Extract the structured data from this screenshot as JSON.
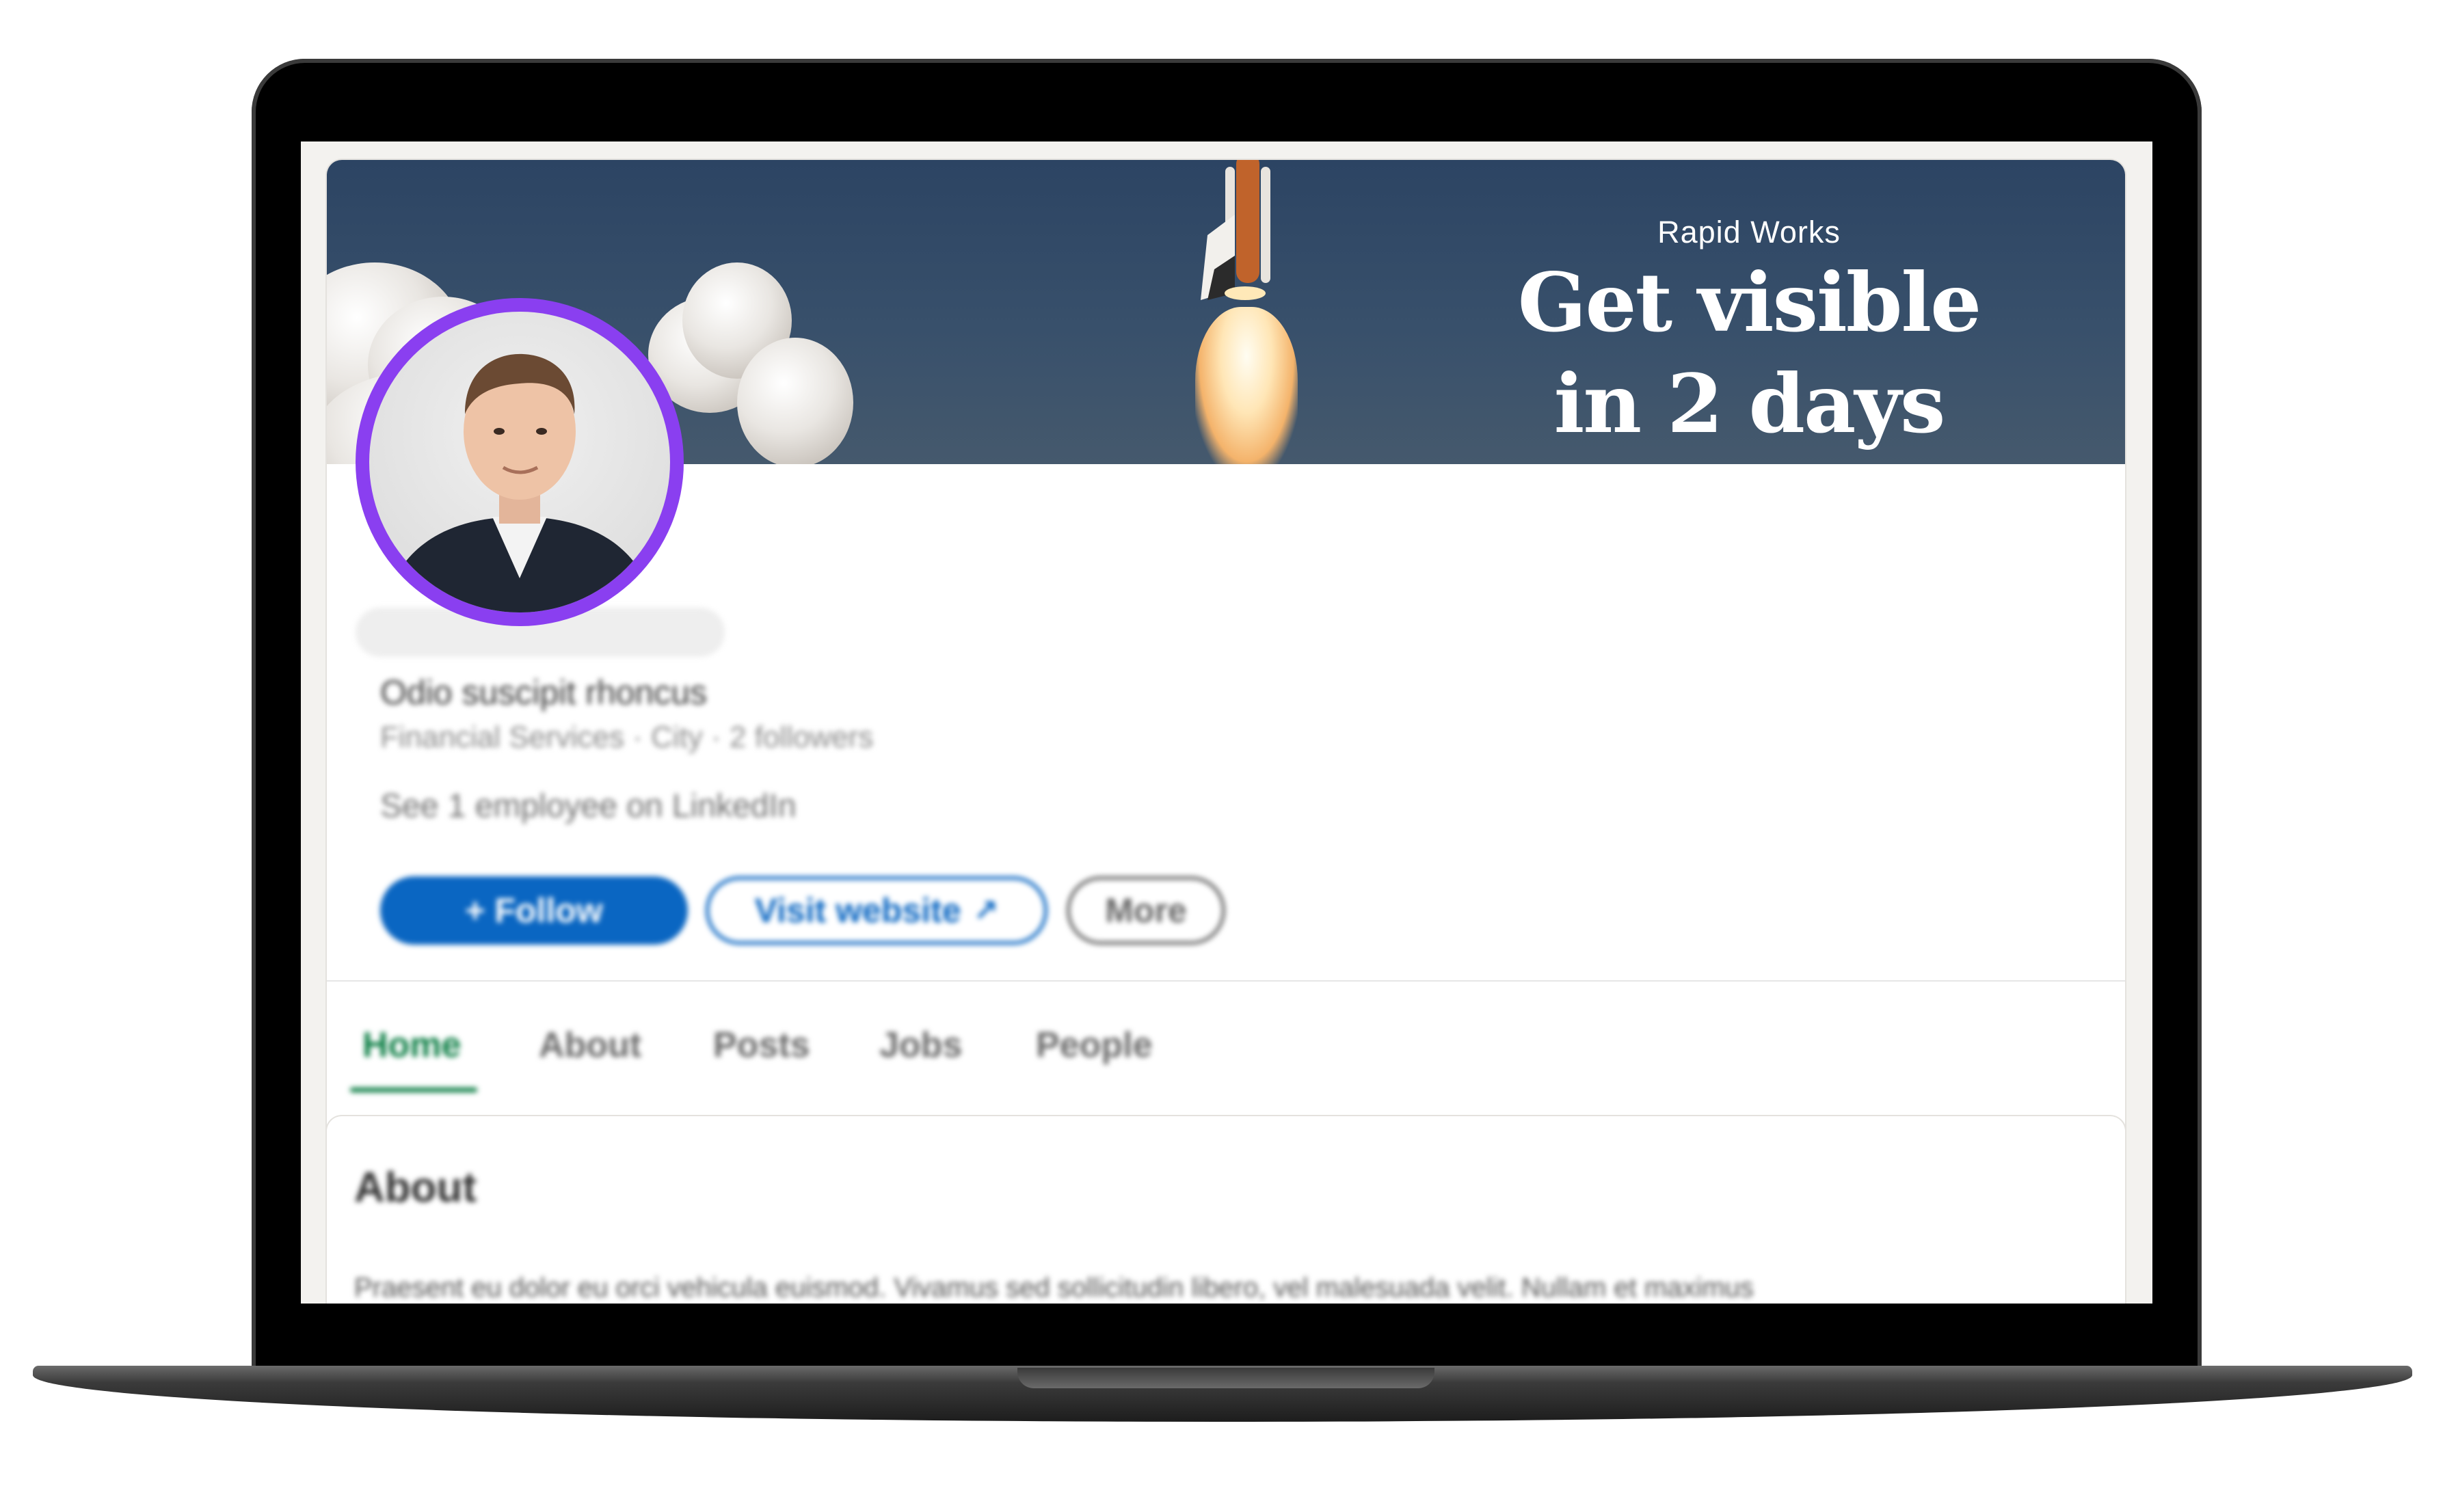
{
  "cover": {
    "brand": "Rapid Works",
    "headline_line1": "Get visible",
    "headline_line2": "in 2 days"
  },
  "company": {
    "name": "",
    "tagline": "Odio suscipit rhoncus",
    "meta": "Financial Services · City · 2 followers",
    "employees_link": "See 1 employee on LinkedIn"
  },
  "actions": {
    "follow_label": "+ Follow",
    "visit_label": "Visit website",
    "more_label": "More"
  },
  "tabs": [
    {
      "label": "Home",
      "active": true
    },
    {
      "label": "About",
      "active": false
    },
    {
      "label": "Posts",
      "active": false
    },
    {
      "label": "Jobs",
      "active": false
    },
    {
      "label": "People",
      "active": false
    }
  ],
  "about": {
    "heading": "About",
    "text": "Praesent eu dolor eu orci vehicula euismod. Vivamus sed sollicitudin libero, vel malesuada velit. Nullam et maximus"
  },
  "colors": {
    "accent_blue": "#0a66c2",
    "active_tab": "#0a7d43",
    "avatar_ring": "#8a3ff0",
    "cover_bg": "#38506b"
  },
  "icons": {
    "external_link": "external-link-icon"
  }
}
